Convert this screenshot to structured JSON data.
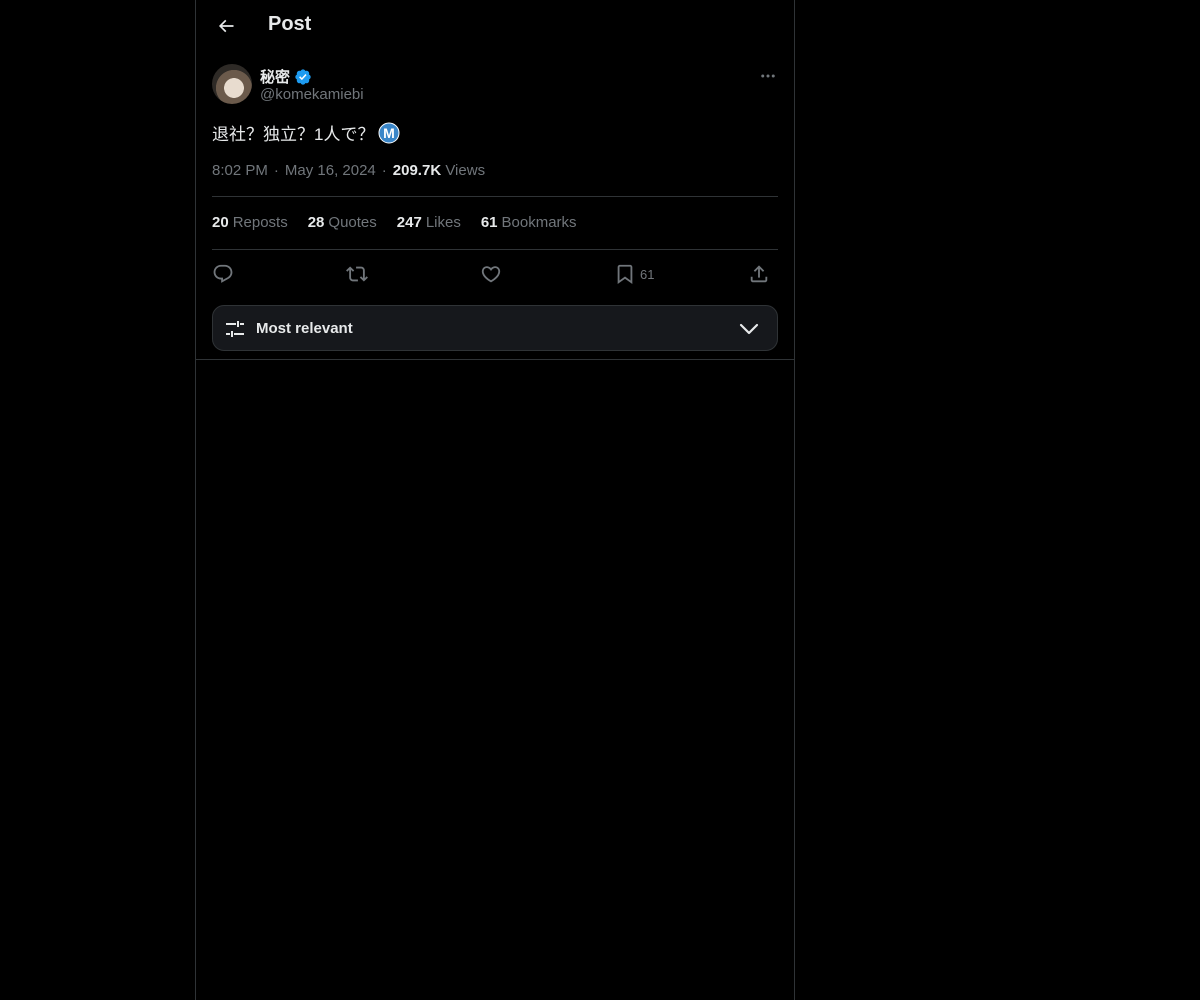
{
  "header": {
    "title": "Post",
    "back_icon": "arrow-left-icon"
  },
  "post": {
    "author": {
      "name": "秘密",
      "handle": "@komekamiebi",
      "verified": true,
      "verified_color": "#1d9bf0"
    },
    "text": "退社？独立？1人で？",
    "text_badge_icon": "m-badge-icon",
    "time": "8:02 PM",
    "date": "May 16, 2024",
    "views_count": "209.7K",
    "views_label": "Views"
  },
  "stats": {
    "reposts": {
      "count": "20",
      "label": "Reposts"
    },
    "quotes": {
      "count": "28",
      "label": "Quotes"
    },
    "likes": {
      "count": "247",
      "label": "Likes"
    },
    "bookmarks": {
      "count": "61",
      "label": "Bookmarks"
    }
  },
  "actions": {
    "reply_icon": "reply-icon",
    "repost_icon": "repost-icon",
    "like_icon": "heart-icon",
    "bookmark_icon": "bookmark-icon",
    "bookmark_count": "61",
    "share_icon": "share-icon"
  },
  "sort": {
    "label": "Most relevant",
    "icon": "sliders-icon",
    "chevron": "chevron-down-icon"
  },
  "colors": {
    "background": "#000000",
    "text": "#e7e9ea",
    "muted": "#71767b",
    "border": "#2f3336",
    "accent": "#1d9bf0"
  }
}
